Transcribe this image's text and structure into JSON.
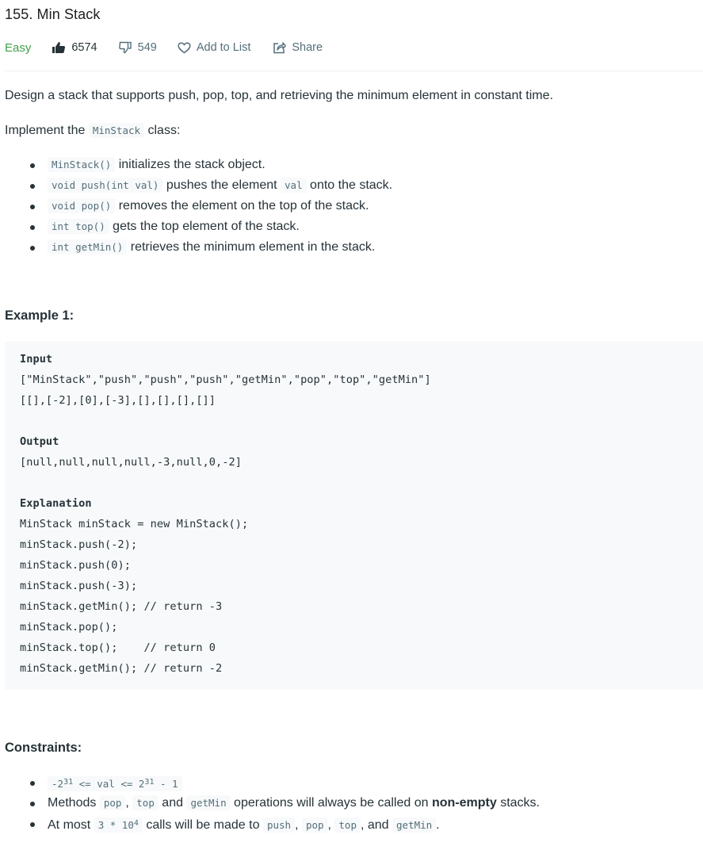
{
  "problem": {
    "title": "155. Min Stack",
    "difficulty": "Easy",
    "likes": "6574",
    "dislikes": "549",
    "add_to_list": "Add to List",
    "share": "Share"
  },
  "colors": {
    "easy": "#43a047",
    "meta_text": "#546e7a",
    "code_bg": "#f7f9fa"
  },
  "description": {
    "intro": "Design a stack that supports push, pop, top, and retrieving the minimum element in constant time.",
    "implement_pre": "Implement the ",
    "implement_code": "MinStack",
    "implement_post": " class:",
    "methods": [
      {
        "code": "MinStack()",
        "text": " initializes the stack object."
      },
      {
        "code": "void push(int val)",
        "text": " pushes the element ",
        "code2": "val",
        "text2": " onto the stack."
      },
      {
        "code": "void pop()",
        "text": " removes the element on the top of the stack."
      },
      {
        "code": "int top()",
        "text": " gets the top element of the stack."
      },
      {
        "code": "int getMin()",
        "text": " retrieves the minimum element in the stack."
      }
    ]
  },
  "example": {
    "heading": "Example 1:",
    "input_label": "Input",
    "input_line1": "[\"MinStack\",\"push\",\"push\",\"push\",\"getMin\",\"pop\",\"top\",\"getMin\"]",
    "input_line2": "[[],[-2],[0],[-3],[],[],[],[]]",
    "output_label": "Output",
    "output_line": "[null,null,null,null,-3,null,0,-2]",
    "explanation_label": "Explanation",
    "explanation_lines": [
      "MinStack minStack = new MinStack();",
      "minStack.push(-2);",
      "minStack.push(0);",
      "minStack.push(-3);",
      "minStack.getMin(); // return -3",
      "minStack.pop();",
      "minStack.top();    // return 0",
      "minStack.getMin(); // return -2"
    ]
  },
  "constraints": {
    "heading": "Constraints:",
    "c1": {
      "a": "-2",
      "a_exp": "31",
      "b": " <= val <= 2",
      "b_exp": "31",
      "c": " - 1"
    },
    "c2": {
      "pre": "Methods ",
      "pop": "pop",
      "sep1": ", ",
      "top": "top",
      "and": " and ",
      "getMin": "getMin",
      "mid": " operations will always be called on ",
      "bold": "non-empty",
      "post": " stacks."
    },
    "c3": {
      "pre": "At most ",
      "num": "3 * 10",
      "num_exp": "4",
      "mid": " calls will be made to ",
      "push": "push",
      "sep1": ", ",
      "pop": "pop",
      "sep2": ", ",
      "top": "top",
      "and": ", and ",
      "getMin": "getMin",
      "post": "."
    }
  }
}
